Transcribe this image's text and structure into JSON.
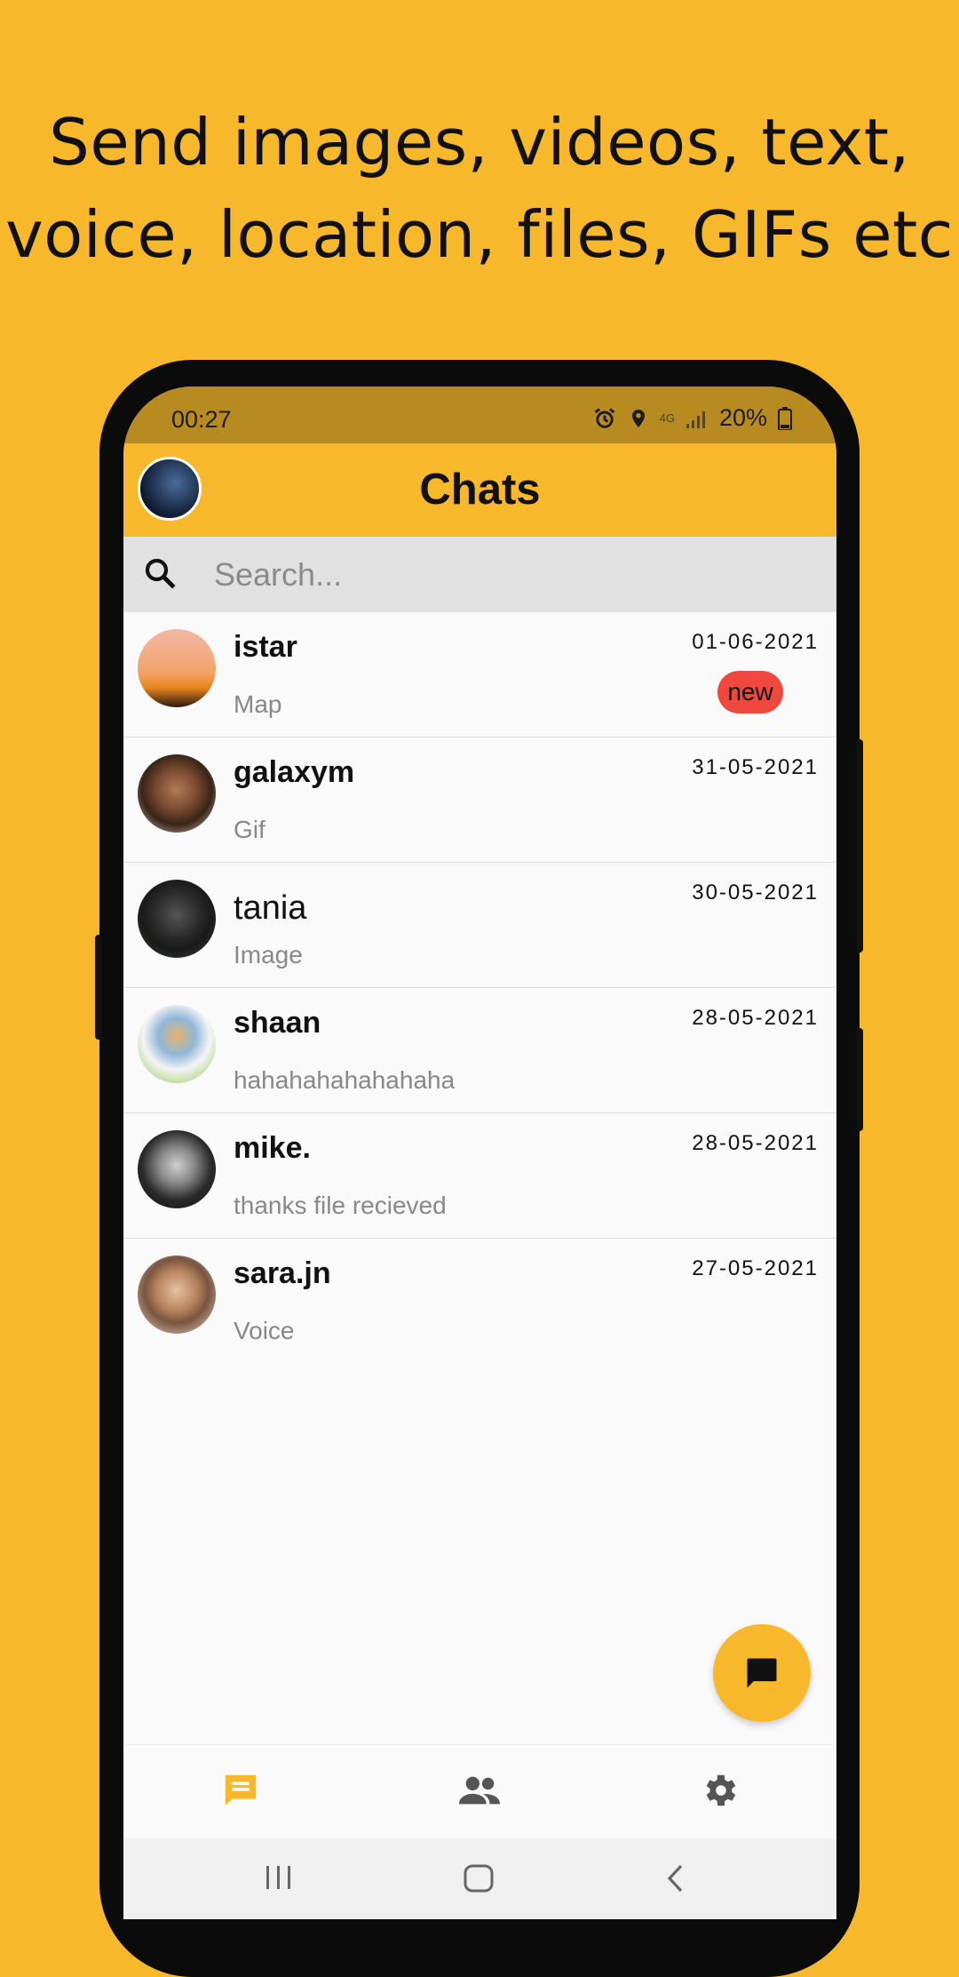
{
  "promo": {
    "line1": "Send images, videos, text,",
    "line2": "voice, location, files, GIFs etc"
  },
  "status": {
    "time": "00:27",
    "network": "4G",
    "battery": "20%",
    "icons": [
      "alarm-icon",
      "location-icon",
      "signal-icon",
      "battery-icon"
    ]
  },
  "appbar": {
    "title": "Chats"
  },
  "search": {
    "placeholder": "Search..."
  },
  "chats": [
    {
      "name": "istar",
      "message": "Map",
      "date": "01-06-2021",
      "badge": "new"
    },
    {
      "name": "galaxym",
      "message": "Gif",
      "date": "31-05-2021"
    },
    {
      "name": "tania",
      "message": "Image",
      "date": "30-05-2021"
    },
    {
      "name": "shaan",
      "message": "hahahahahahahaha",
      "date": "28-05-2021"
    },
    {
      "name": "mike.",
      "message": "thanks file recieved",
      "date": "28-05-2021"
    },
    {
      "name": "sara.jn",
      "message": "Voice",
      "date": "27-05-2021"
    }
  ],
  "bottom_nav": [
    {
      "icon": "chat-icon",
      "active": true
    },
    {
      "icon": "people-icon",
      "active": false
    },
    {
      "icon": "settings-icon",
      "active": false
    }
  ],
  "colors": {
    "accent": "#F7B82B",
    "status_bar": "#B88B21",
    "badge": "#F0473E"
  }
}
